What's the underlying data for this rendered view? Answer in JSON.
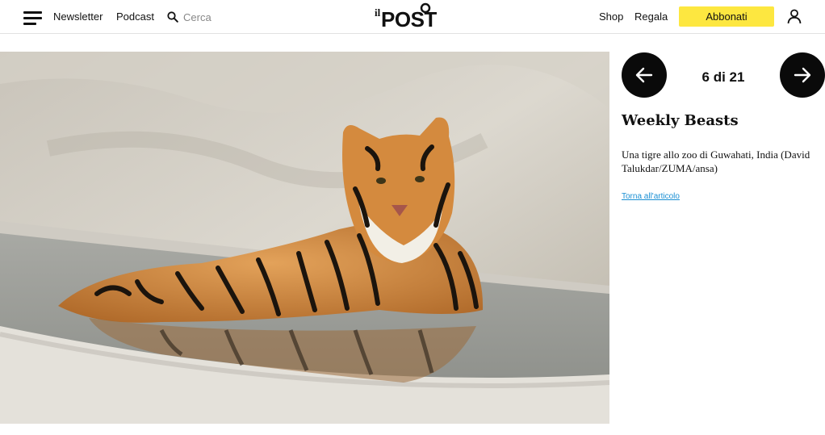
{
  "header": {
    "nav": {
      "newsletter": "Newsletter",
      "podcast": "Podcast"
    },
    "search": {
      "placeholder": "Cerca"
    },
    "logo": {
      "small_text": "il",
      "main_text": "POST"
    },
    "shop_label": "Shop",
    "gift_label": "Regala",
    "subscribe_label": "Abbonati",
    "accent_color": "#fde740"
  },
  "gallery": {
    "counter": "6 di 21",
    "title": "Weekly Beasts",
    "caption": "Una tigre allo zoo di Guwahati, India (David Talukdar/ZUMA/ansa)",
    "back_link": "Torna all'articolo",
    "link_color": "#1a8fd3"
  },
  "icons": {
    "menu": "menu-icon",
    "search": "search-icon",
    "user": "user-icon",
    "prev": "arrow-left-icon",
    "next": "arrow-right-icon"
  }
}
